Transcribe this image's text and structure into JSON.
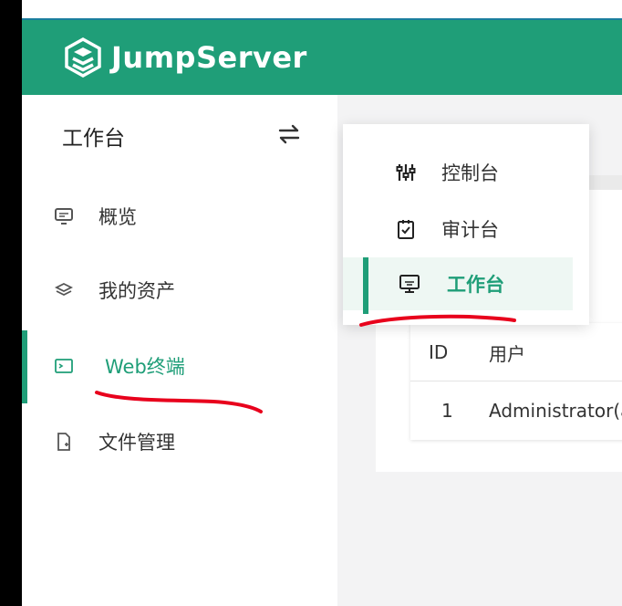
{
  "app": {
    "brand": "JumpServer",
    "accent_color": "#1f9e78",
    "logo_icon": "layers-logo-icon"
  },
  "sidebar": {
    "title": "工作台",
    "switch_icon": "swap-arrows-icon",
    "items": [
      {
        "label": "概览",
        "icon": "monitor-icon",
        "active": false
      },
      {
        "label": "我的资产",
        "icon": "layers-icon",
        "active": false
      },
      {
        "label": "Web终端",
        "icon": "terminal-icon",
        "active": true
      },
      {
        "label": "文件管理",
        "icon": "file-icon",
        "active": false
      }
    ]
  },
  "view_switcher": {
    "items": [
      {
        "label": "控制台",
        "icon": "sliders-icon",
        "active": false
      },
      {
        "label": "审计台",
        "icon": "clipboard-check-icon",
        "active": false
      },
      {
        "label": "工作台",
        "icon": "desktop-icon",
        "active": true
      }
    ]
  },
  "table": {
    "columns": [
      "ID",
      "用户"
    ],
    "rows": [
      [
        "1",
        "Administrator(a"
      ]
    ]
  },
  "annotation_color": "#e8001c"
}
